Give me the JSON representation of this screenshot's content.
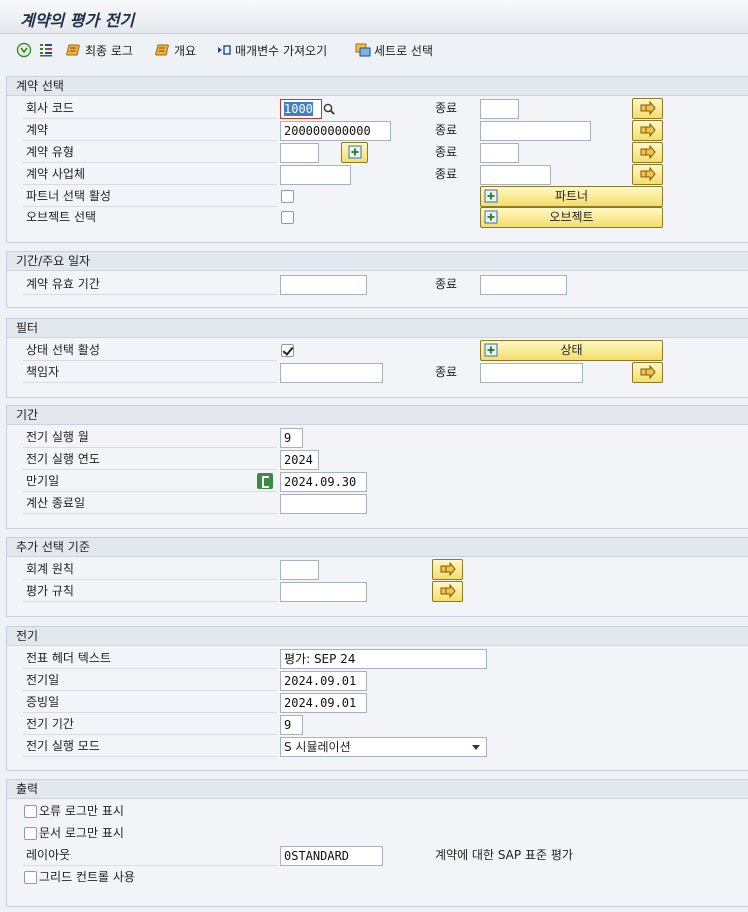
{
  "window": {
    "title": "계약의 평가 전기"
  },
  "toolbar": {
    "execute": "",
    "last_log": "최종 로그",
    "overview": "개요",
    "get_variant": "매개변수 가져오기",
    "selection_set": "세트로 선택"
  },
  "sections": {
    "contract_selection": {
      "title": "계약 선택",
      "company_code": {
        "label": "회사 코드",
        "value": "1000",
        "to_label": "종료",
        "to_value": ""
      },
      "contract": {
        "label": "계약",
        "value": "200000000000",
        "to_label": "종료",
        "to_value": ""
      },
      "contract_type": {
        "label": "계약 유형",
        "value": "",
        "to_label": "종료",
        "to_value": ""
      },
      "contract_entity": {
        "label": "계약 사업체",
        "value": "",
        "to_label": "종료",
        "to_value": ""
      },
      "partner_active": {
        "label": "파트너 선택 활성",
        "checked": false,
        "button": "파트너"
      },
      "object_select": {
        "label": "오브젝트 선택",
        "checked": false,
        "button": "오브젝트"
      }
    },
    "period_dates": {
      "title": "기간/주요 일자",
      "validity": {
        "label": "계약 유효 기간",
        "value": "",
        "to_label": "종료",
        "to_value": ""
      }
    },
    "filter": {
      "title": "필터",
      "status_active": {
        "label": "상태 선택 활성",
        "checked": true,
        "button": "상태"
      },
      "responsible": {
        "label": "책임자",
        "value": "",
        "to_label": "종료",
        "to_value": ""
      }
    },
    "period": {
      "title": "기간",
      "posting_month": {
        "label": "전기 실행 월",
        "value": "9"
      },
      "posting_year": {
        "label": "전기 실행 연도",
        "value": "2024"
      },
      "due_date": {
        "label": "만기일",
        "value": "2024.09.30"
      },
      "calc_end": {
        "label": "계산 종료일",
        "value": ""
      }
    },
    "additional": {
      "title": "추가 선택 기준",
      "accounting_principle": {
        "label": "회계 원칙",
        "value": ""
      },
      "valuation_rule": {
        "label": "평가 규칙",
        "value": ""
      }
    },
    "posting": {
      "title": "전기",
      "header_text": {
        "label": "전표 헤더 텍스트",
        "value": "평가: SEP 24"
      },
      "posting_date": {
        "label": "전기일",
        "value": "2024.09.01"
      },
      "document_date": {
        "label": "증빙일",
        "value": "2024.09.01"
      },
      "posting_period": {
        "label": "전기 기간",
        "value": "9"
      },
      "run_mode": {
        "label": "전기 실행 모드",
        "value": "S 시뮬레이션"
      }
    },
    "output": {
      "title": "출력",
      "error_log_only": {
        "label": "오류 로그만 표시",
        "checked": false
      },
      "doc_log_only": {
        "label": "문서 로그만 표시",
        "checked": false
      },
      "layout": {
        "label": "레이아웃",
        "value": "0STANDARD",
        "description": "계약에 대한 SAP 표준 평가"
      },
      "grid_control": {
        "label": "그리드 컨트롤 사용",
        "checked": false
      }
    }
  },
  "colors": {
    "button_yellow": "#f5de6a",
    "header_bg": "#e3e8ef",
    "accent_focus": "#c0392b"
  }
}
